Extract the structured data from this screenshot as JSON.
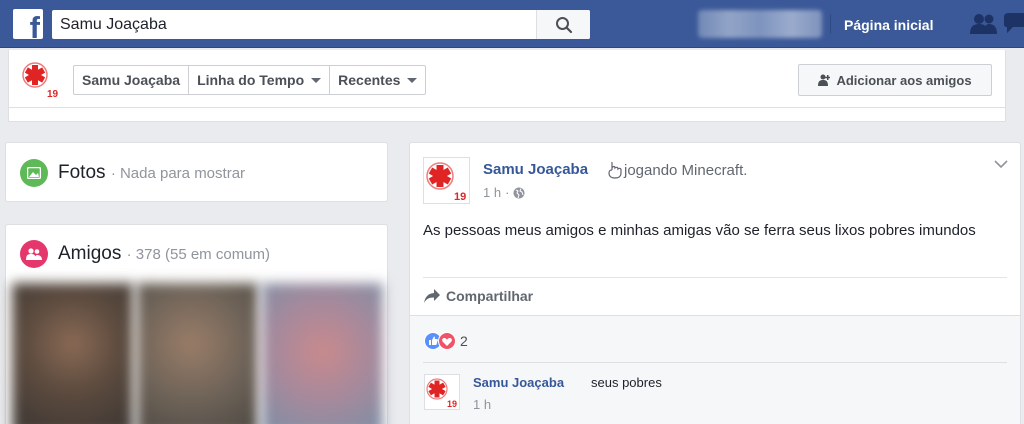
{
  "topbar": {
    "logo_letter": "f",
    "search_value": "Samu Joaçaba",
    "home_label": "Página inicial"
  },
  "profile_nav": {
    "tabs": [
      {
        "label": "Samu Joaçaba",
        "has_caret": false
      },
      {
        "label": "Linha do Tempo",
        "has_caret": true
      },
      {
        "label": "Recentes",
        "has_caret": true
      }
    ],
    "add_friend_label": "Adicionar aos amigos"
  },
  "photos_section": {
    "title": "Fotos",
    "subtitle": "· Nada para mostrar",
    "icon_color": "#5fb958"
  },
  "friends_section": {
    "title": "Amigos",
    "subtitle": "· 378 (55 em comum)",
    "icon_color": "#e4386c"
  },
  "avatar_text": "19",
  "post": {
    "author": "Samu Joaçaba",
    "activity": "jogando Minecraft.",
    "time": "1 h",
    "separator": "·",
    "text": "As pessoas meus amigos e minhas amigas vão se ferra seus lixos pobres imundos",
    "share_label": "Compartilhar",
    "reaction_count": "2"
  },
  "comment": {
    "author": "Samu Joaçaba",
    "text": "seus pobres",
    "time": "1 h"
  },
  "colors": {
    "brand": "#3b5998",
    "link": "#365899",
    "samu_red": "#e02424"
  }
}
